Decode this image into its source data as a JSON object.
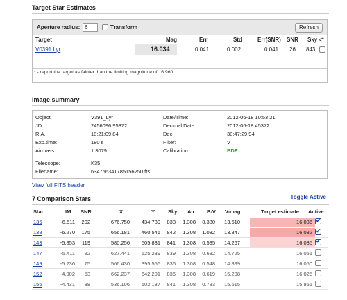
{
  "target_section": {
    "title": "Target Star Estimates",
    "aperture_label": "Aperture radius:",
    "aperture_value": "6",
    "transform_label": "Transform",
    "refresh_label": "Refresh",
    "columns": [
      "Target",
      "Mag",
      "Err",
      "Std",
      "Err(SNR)",
      "SNR",
      "Sky",
      "<*"
    ],
    "row": {
      "target": "V0391 Lyr",
      "mag": "16.034",
      "err": "0.041",
      "std": "0.002",
      "err_snr": "0.041",
      "snr": "26",
      "sky": "843"
    },
    "note": "* - report the target as fainter than the limiting magnitude of 16.960"
  },
  "summary": {
    "title": "Image summary",
    "left": [
      {
        "k": "Object:",
        "v": "V391_Lyr"
      },
      {
        "k": "JD:",
        "v": "2456096.95372"
      },
      {
        "k": "R.A.:",
        "v": "18:21:09.84"
      },
      {
        "k": "Exp.time:",
        "v": "180 s"
      },
      {
        "k": "Airmass:",
        "v": "1.3079"
      }
    ],
    "right": [
      {
        "k": "Date/Time:",
        "v": "2012-06-18 10:53:21"
      },
      {
        "k": "Decimal Date:",
        "v": "2012-06-18.45372"
      },
      {
        "k": "Dec:",
        "v": "38:47:29.94"
      },
      {
        "k": "Filter:",
        "v": "V"
      },
      {
        "k": "Calibration:",
        "v": "BDF"
      }
    ],
    "telescope_label": "Telescope:",
    "telescope": "K35",
    "filename_label": "Filename:",
    "filename": "634756341785156250.fts",
    "fits_link": "View full FITS header"
  },
  "comparison": {
    "title": "7 Comparison Stars",
    "toggle_label": "Toggle Active",
    "columns": [
      "Star",
      "IM",
      "SNR",
      "X",
      "Y",
      "Sky",
      "Air",
      "B-V",
      "V-mag",
      "Target estimate",
      "Active"
    ],
    "rows": [
      {
        "star": "136",
        "im": "-6.511",
        "snr": "202",
        "x": "676.750",
        "y": "434.789",
        "sky": "838",
        "air": "1.308",
        "bv": "0.380",
        "vmag": "13.610",
        "te": "16.036",
        "active": true,
        "shade": "#f7b6b6"
      },
      {
        "star": "138",
        "im": "-6.270",
        "snr": "175",
        "x": "656.181",
        "y": "460.546",
        "sky": "842",
        "air": "1.308",
        "bv": "1.082",
        "vmag": "13.847",
        "te": "16.032",
        "active": true,
        "shade": "#f5a9a9"
      },
      {
        "star": "143",
        "im": "-5.853",
        "snr": "119",
        "x": "580.256",
        "y": "505.831",
        "sky": "841",
        "air": "1.308",
        "bv": "0.535",
        "vmag": "14.267",
        "te": "16.035",
        "active": true,
        "shade": "#fbd3d3"
      },
      {
        "star": "147",
        "im": "-5.411",
        "snr": "82",
        "x": "627.441",
        "y": "525.239",
        "sky": "839",
        "air": "1.308",
        "bv": "0.632",
        "vmag": "14.725",
        "te": "16.051",
        "active": false,
        "shade": ""
      },
      {
        "star": "149",
        "im": "-5.236",
        "snr": "75",
        "x": "566.430",
        "y": "395.556",
        "sky": "836",
        "air": "1.308",
        "bv": "0.548",
        "vmag": "14.899",
        "te": "16.050",
        "active": false,
        "shade": ""
      },
      {
        "star": "152",
        "im": "-4.902",
        "snr": "53",
        "x": "662.237",
        "y": "642.201",
        "sky": "836",
        "air": "1.308",
        "bv": "0.619",
        "vmag": "15.208",
        "te": "16.025",
        "active": false,
        "shade": ""
      },
      {
        "star": "156",
        "im": "-4.431",
        "snr": "38",
        "x": "536.106",
        "y": "502.137",
        "sky": "841",
        "air": "1.308",
        "bv": "0.783",
        "vmag": "15.615",
        "te": "15.961",
        "active": false,
        "shade": ""
      }
    ]
  }
}
